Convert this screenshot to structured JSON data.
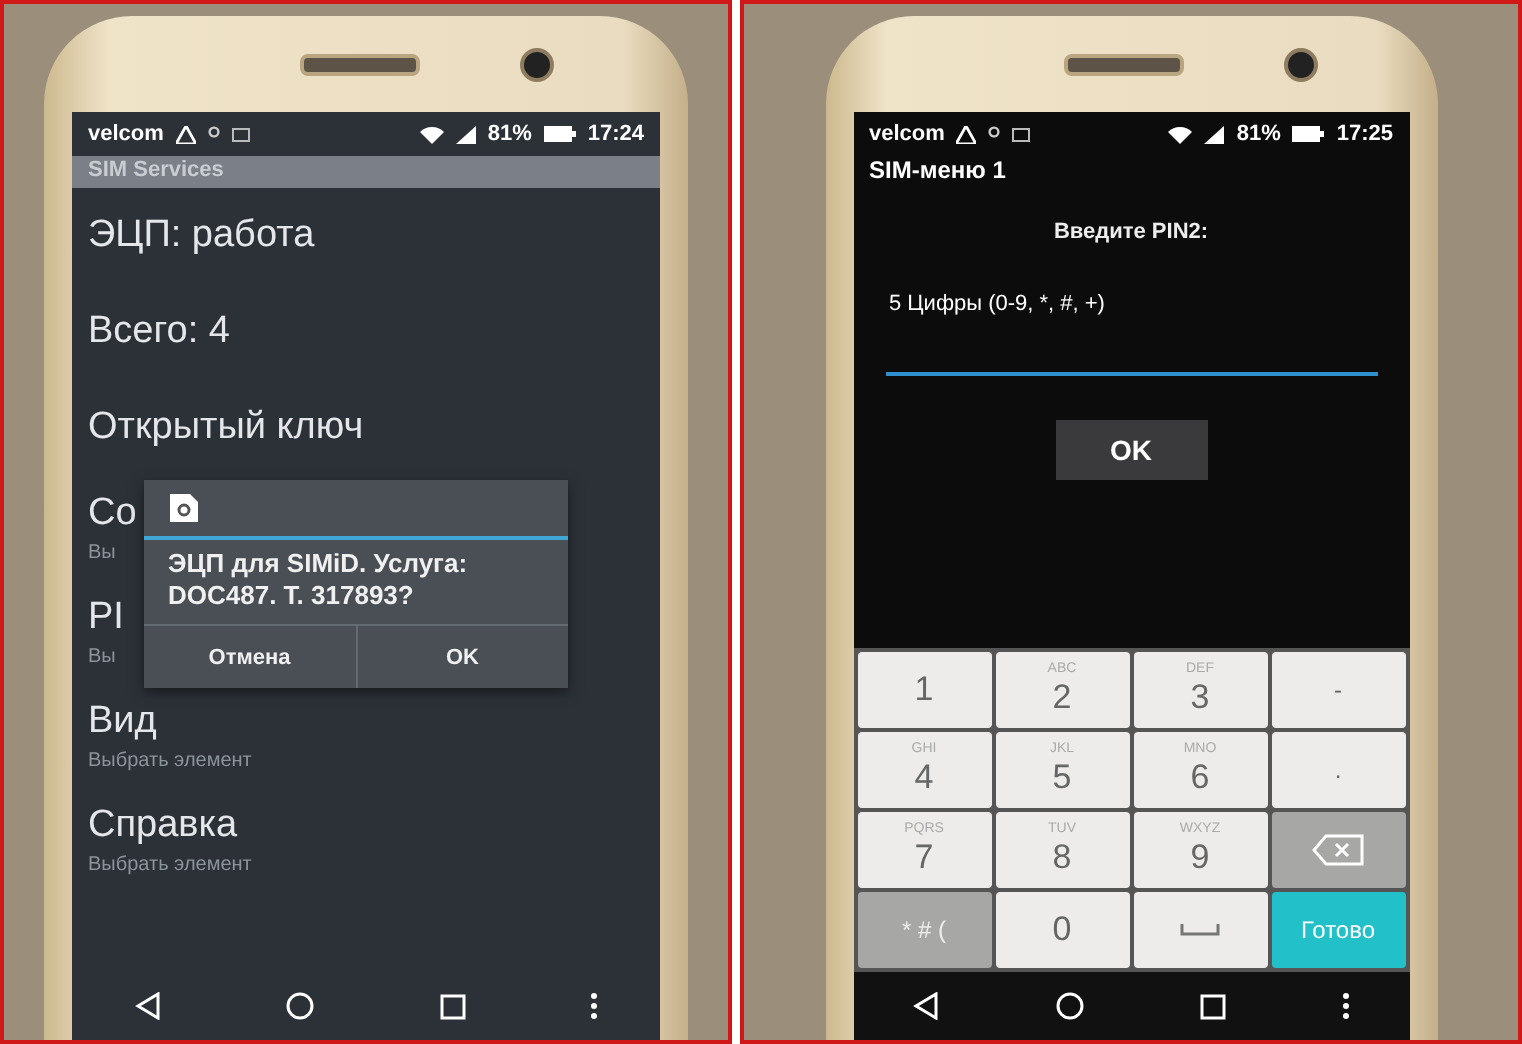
{
  "left_phone": {
    "status_bar": {
      "carrier": "velcom",
      "battery": "81%",
      "time": "17:24"
    },
    "title_bar": "SIM Services",
    "items": [
      {
        "title": "ЭЦП: работа"
      },
      {
        "title": "Всего: 4"
      },
      {
        "title": "Открытый ключ"
      },
      {
        "title": "Со",
        "subtitle": "Вы"
      },
      {
        "title": "PI",
        "subtitle": "Вы"
      },
      {
        "title": "Вид",
        "subtitle": "Выбрать элемент"
      },
      {
        "title": "Справка",
        "subtitle": "Выбрать элемент"
      }
    ],
    "dialog": {
      "message": "ЭЦП для SIMiD. Услуга: DOC487. T. 317893?",
      "buttons": [
        "Отмена",
        "OK"
      ]
    }
  },
  "right_phone": {
    "status_bar": {
      "carrier": "velcom",
      "battery": "81%",
      "time": "17:25"
    },
    "title": "SIM-меню 1",
    "prompt": "Введите PIN2:",
    "hint": "5 Цифры (0-9, *, #, +)",
    "ok_button": "OK",
    "keypad": [
      {
        "kind": "digit",
        "label": "1"
      },
      {
        "kind": "digit",
        "label": "2",
        "letters": "ABC"
      },
      {
        "kind": "digit",
        "label": "3",
        "letters": "DEF"
      },
      {
        "kind": "symbol",
        "label": "-"
      },
      {
        "kind": "digit",
        "label": "4",
        "letters": "GHI"
      },
      {
        "kind": "digit",
        "label": "5",
        "letters": "JKL"
      },
      {
        "kind": "digit",
        "label": "6",
        "letters": "MNO"
      },
      {
        "kind": "symbol",
        "label": "."
      },
      {
        "kind": "digit",
        "label": "7",
        "letters": "PQRS"
      },
      {
        "kind": "digit",
        "label": "8",
        "letters": "TUV"
      },
      {
        "kind": "digit",
        "label": "9",
        "letters": "WXYZ"
      },
      {
        "kind": "backspace"
      },
      {
        "kind": "mode",
        "label": "* # ("
      },
      {
        "kind": "digit",
        "label": "0"
      },
      {
        "kind": "space"
      },
      {
        "kind": "done",
        "label": "Готово"
      }
    ]
  }
}
